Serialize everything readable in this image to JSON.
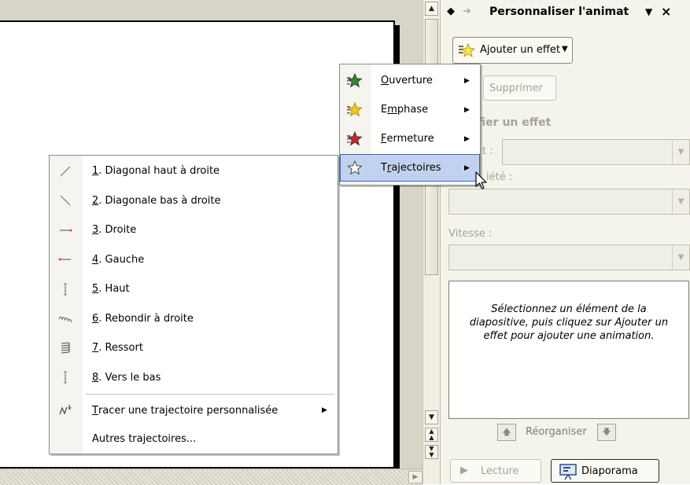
{
  "task_pane": {
    "title": "Personnaliser l'animat",
    "title_dropdown_glyph": "▼",
    "close_glyph": "×",
    "add_effect_label": "Ajouter un effet",
    "delete_label": "Supprimer",
    "modify_heading": "ifier un effet",
    "start_label": "t :",
    "property_label": "iété :",
    "speed_label": "Vitesse :",
    "info_text": "Sélectionnez un élément de la diapositive, puis cliquez sur Ajouter un effet pour ajouter une animation.",
    "reorder_label": "Réorganiser",
    "play_label": "Lecture",
    "slideshow_label": "Diaporama"
  },
  "effect_menu": {
    "items": [
      {
        "pre": "",
        "key": "O",
        "post": "uverture",
        "icon": "star-green-icon",
        "color": "#2a8a2a"
      },
      {
        "pre": "E",
        "key": "m",
        "post": "phase",
        "icon": "star-yellow-icon",
        "color": "#f2c81e"
      },
      {
        "pre": "",
        "key": "F",
        "post": "ermeture",
        "icon": "star-red-icon",
        "color": "#d42020"
      },
      {
        "pre": "T",
        "key": "r",
        "post": "ajectoires",
        "icon": "star-outline-icon",
        "color": "#ffffff"
      }
    ],
    "highlighted_index": 3
  },
  "trajectory_menu": {
    "items": [
      {
        "num": "1",
        "text": ". Diagonal haut à droite",
        "icon": "diagonal-up-icon"
      },
      {
        "num": "2",
        "text": ". Diagonale bas à droite",
        "icon": "diagonal-down-icon"
      },
      {
        "num": "3",
        "text": ". Droite",
        "icon": "line-right-icon"
      },
      {
        "num": "4",
        "text": ". Gauche",
        "icon": "line-left-icon"
      },
      {
        "num": "5",
        "text": ". Haut",
        "icon": "line-up-icon"
      },
      {
        "num": "6",
        "text": ". Rebondir à droite",
        "icon": "bounce-right-icon"
      },
      {
        "num": "7",
        "text": ". Ressort",
        "icon": "spring-icon"
      },
      {
        "num": "8",
        "text": ". Vers le bas",
        "icon": "line-down-icon"
      }
    ],
    "custom_path": {
      "key": "T",
      "text": "racer une trajectoire personnalisée",
      "icon": "custom-path-icon"
    },
    "more_paths": "Autres trajectoires..."
  }
}
